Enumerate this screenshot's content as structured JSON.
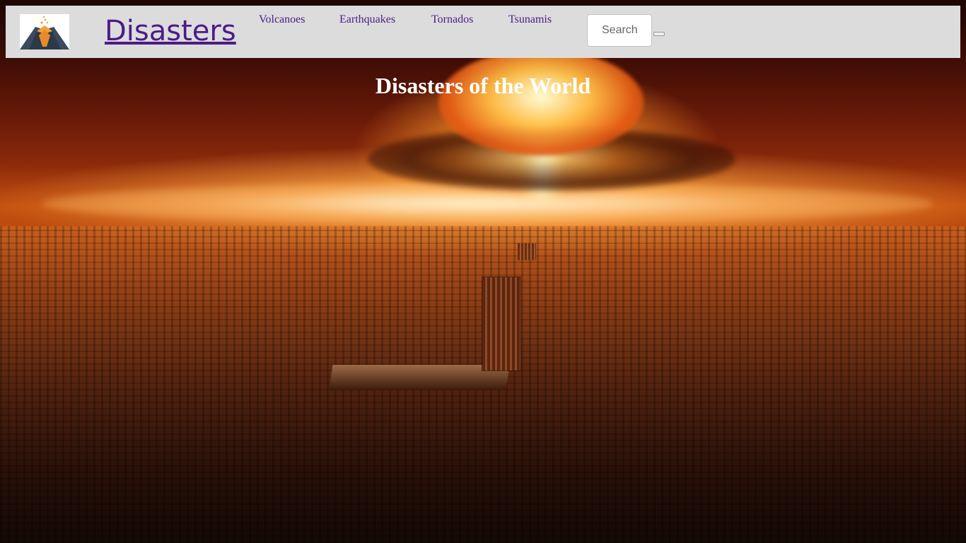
{
  "navbar": {
    "logo_icon": "volcano-icon",
    "brand": "Disasters",
    "links": [
      {
        "label": "Volcanoes"
      },
      {
        "label": "Earthquakes"
      },
      {
        "label": "Tornados"
      },
      {
        "label": "Tsunamis"
      }
    ],
    "search": {
      "placeholder": "Search",
      "value": "",
      "button_label": ""
    }
  },
  "hero": {
    "title": "Disasters of the World",
    "background": "nuclear-explosion-over-city-image"
  },
  "colors": {
    "navbar_bg": "#dcdcdc",
    "brand_text": "#4b1c86",
    "link_text": "#4b1c86",
    "hero_title": "#ffffff"
  }
}
